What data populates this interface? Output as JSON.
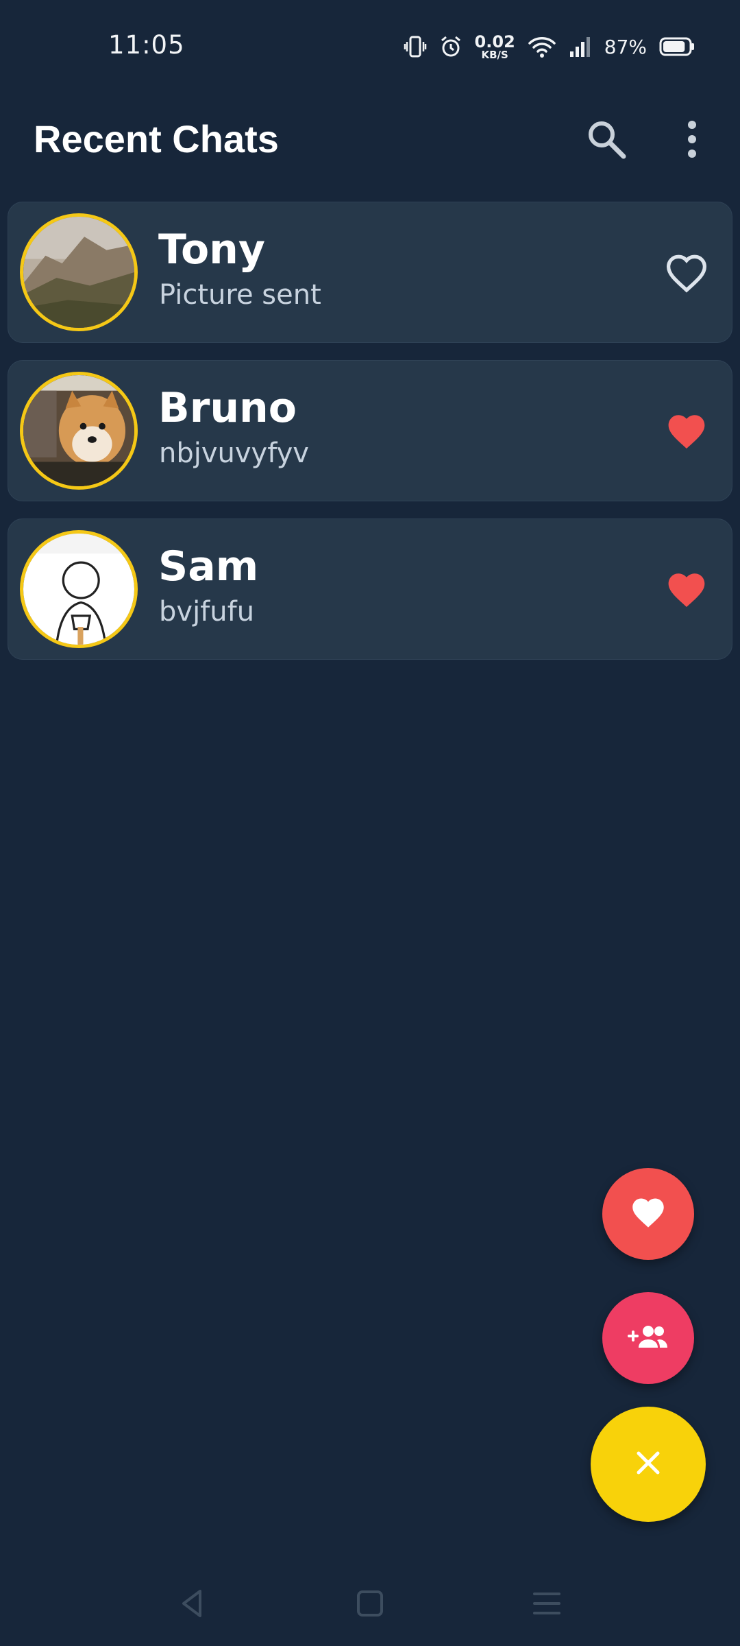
{
  "status_bar": {
    "time": "11:05",
    "net_speed_value": "0.02",
    "net_speed_unit": "KB/S",
    "battery_percent": "87%",
    "battery_level": 0.87,
    "icons": [
      "vibrate-icon",
      "alarm-icon",
      "wifi-icon",
      "signal-icon",
      "battery-icon"
    ]
  },
  "app_bar": {
    "title": "Recent Chats",
    "search_icon": "search-icon",
    "more_icon": "more-vert-icon"
  },
  "chats": [
    {
      "name": "Tony",
      "last_message": "Picture sent",
      "favorite": false,
      "avatar": "landscape-photo"
    },
    {
      "name": "Bruno",
      "last_message": "nbjvuvyfyv",
      "favorite": true,
      "avatar": "dog-meme-photo"
    },
    {
      "name": "Sam",
      "last_message": "bvjfufu",
      "favorite": true,
      "avatar": "cartoon-meme-photo"
    }
  ],
  "fabs": {
    "favorites_icon": "heart-icon",
    "add_contact_icon": "group-add-icon",
    "close_icon": "close-icon"
  },
  "nav_bar": {
    "icons": [
      "back-icon",
      "home-icon",
      "recents-icon"
    ]
  },
  "colors": {
    "background": "#17263a",
    "card": "#26384a",
    "avatar_ring": "#f5c816",
    "heart_filled": "#f2504f",
    "fab_favorite": "#f2504f",
    "fab_add": "#ee3d63",
    "fab_close": "#f8d20a"
  }
}
